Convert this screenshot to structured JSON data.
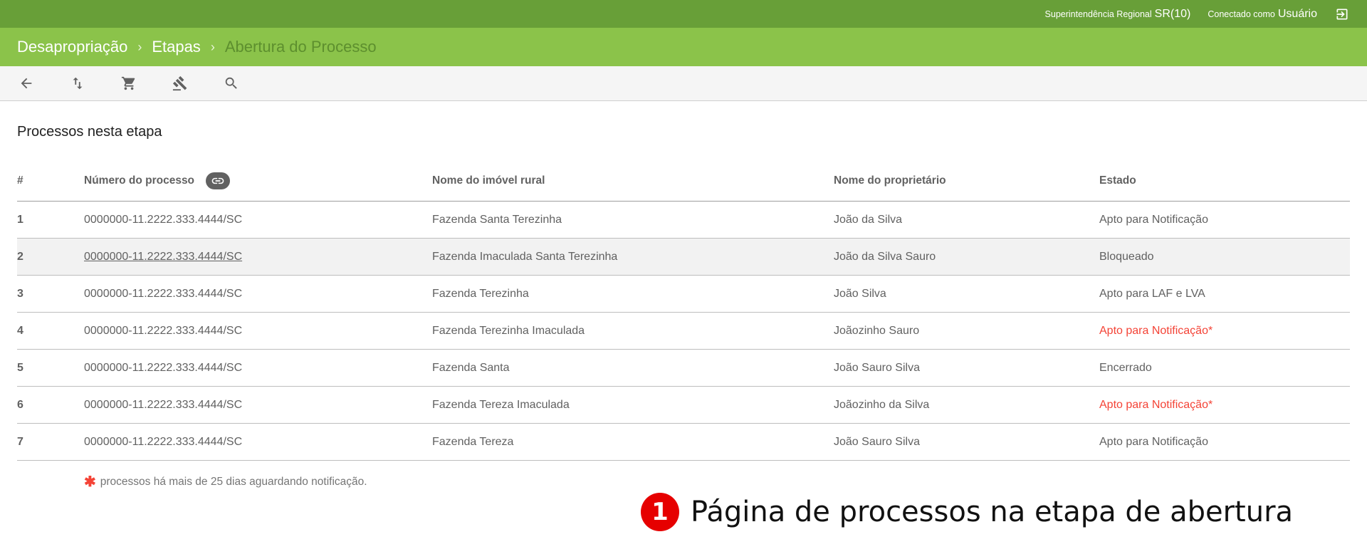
{
  "topbar": {
    "regional_label": "Superintendência Regional",
    "regional_value": "SR(10)",
    "user_label": "Conectado como",
    "user_value": "Usuário",
    "logout_icon": "logout-icon"
  },
  "breadcrumbs": [
    "Desapropriação",
    "Etapas",
    "Abertura do Processo"
  ],
  "breadcrumb_separator": "›",
  "toolbar": {
    "icons": [
      "arrow-back-icon",
      "swap-vertical-icon",
      "cart-icon",
      "gavel-icon",
      "search-icon"
    ]
  },
  "section_title": "Processos nesta etapa",
  "table": {
    "headers": [
      "#",
      "Número do processo",
      "Nome do imóvel rural",
      "Nome do proprietário",
      "Estado"
    ],
    "rows": [
      {
        "idx": "1",
        "numero": "0000000-11.2222.333.4444/SC",
        "imovel": "Fazenda Santa Terezinha",
        "proprietario": "João da Silva",
        "estado": "Apto para Notificação"
      },
      {
        "idx": "2",
        "numero": "0000000-11.2222.333.4444/SC",
        "imovel": "Fazenda Imaculada Santa Terezinha",
        "proprietario": "João da Silva Sauro",
        "estado": "Bloqueado"
      },
      {
        "idx": "3",
        "numero": "0000000-11.2222.333.4444/SC",
        "imovel": "Fazenda Terezinha",
        "proprietario": "João Silva",
        "estado": "Apto para LAF e LVA"
      },
      {
        "idx": "4",
        "numero": "0000000-11.2222.333.4444/SC",
        "imovel": "Fazenda Terezinha Imaculada",
        "proprietario": "Joãozinho Sauro",
        "estado": "Apto para Notificação*"
      },
      {
        "idx": "5",
        "numero": "0000000-11.2222.333.4444/SC",
        "imovel": "Fazenda Santa",
        "proprietario": "João Sauro Silva",
        "estado": "Encerrado"
      },
      {
        "idx": "6",
        "numero": "0000000-11.2222.333.4444/SC",
        "imovel": "Fazenda Tereza Imaculada",
        "proprietario": "Joãozinho da Silva",
        "estado": "Apto para Notificação*"
      },
      {
        "idx": "7",
        "numero": "0000000-11.2222.333.4444/SC",
        "imovel": "Fazenda Tereza",
        "proprietario": "João Sauro Silva",
        "estado": "Apto para Notificação"
      }
    ]
  },
  "footnote": {
    "asterisk": "✱",
    "text": "processos há mais de 25 dias aguardando notificação."
  },
  "caption": {
    "number": "1",
    "text": "Página de processos na etapa de abertura"
  },
  "colors": {
    "topbar": "#689f38",
    "breadcrumb_bar": "#8bc34a",
    "warning": "#f44336",
    "badge": "#e60000"
  }
}
